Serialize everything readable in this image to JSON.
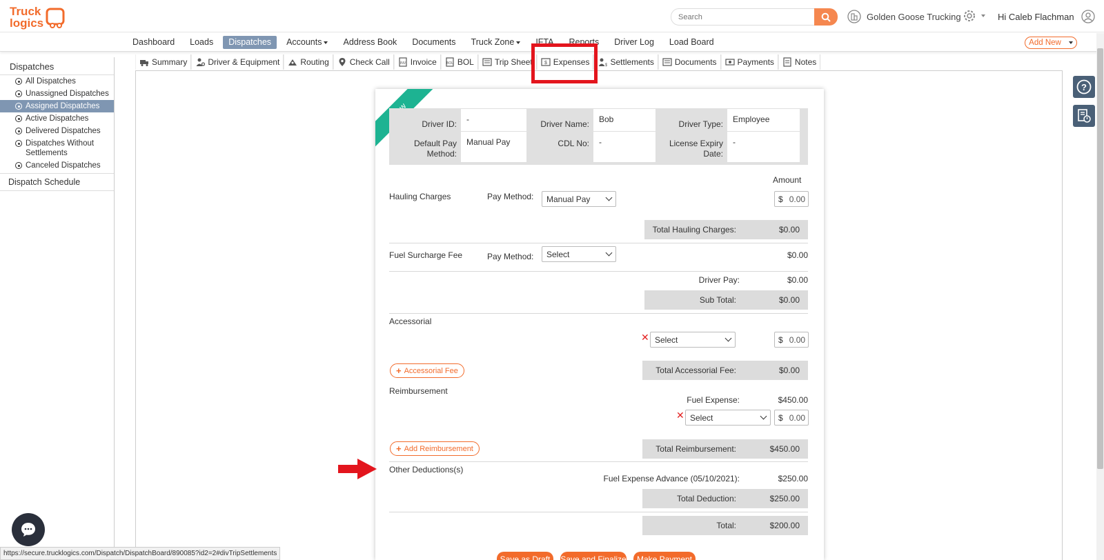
{
  "header": {
    "logo_text": "Truck logics",
    "search_placeholder": "Search",
    "company_name": "Golden Goose Trucking",
    "greeting": "Hi Caleb Flachman",
    "add_new_label": "Add New"
  },
  "main_nav": [
    {
      "label": "Dashboard",
      "active": false,
      "dropdown": false
    },
    {
      "label": "Loads",
      "active": false,
      "dropdown": false
    },
    {
      "label": "Dispatches",
      "active": true,
      "dropdown": false
    },
    {
      "label": "Accounts",
      "active": false,
      "dropdown": true
    },
    {
      "label": "Address Book",
      "active": false,
      "dropdown": false
    },
    {
      "label": "Documents",
      "active": false,
      "dropdown": false
    },
    {
      "label": "Truck Zone",
      "active": false,
      "dropdown": true
    },
    {
      "label": "IFTA",
      "active": false,
      "dropdown": false
    },
    {
      "label": "Reports",
      "active": false,
      "dropdown": false
    },
    {
      "label": "Driver Log",
      "active": false,
      "dropdown": false
    },
    {
      "label": "Load Board",
      "active": false,
      "dropdown": false
    }
  ],
  "sidebar": {
    "title": "Dispatches",
    "items": [
      {
        "label": "All Dispatches",
        "active": false
      },
      {
        "label": "Unassigned Dispatches",
        "active": false
      },
      {
        "label": "Assigned Dispatches",
        "active": true
      },
      {
        "label": "Active Dispatches",
        "active": false
      },
      {
        "label": "Delivered Dispatches",
        "active": false
      },
      {
        "label": "Dispatches Without Settlements",
        "active": false
      },
      {
        "label": "Canceled Dispatches",
        "active": false
      }
    ],
    "schedule_label": "Dispatch Schedule"
  },
  "subtabs": [
    {
      "label": "Summary",
      "icon": "truck-icon"
    },
    {
      "label": "Driver & Equipment",
      "icon": "driver-icon"
    },
    {
      "label": "Routing",
      "icon": "routing-icon"
    },
    {
      "label": "Check Call",
      "icon": "map-pin-icon"
    },
    {
      "label": "Invoice",
      "icon": "invoice-icon"
    },
    {
      "label": "BOL",
      "icon": "bol-icon"
    },
    {
      "label": "Trip Sheet",
      "icon": "trip-sheet-icon"
    },
    {
      "label": "Expenses",
      "icon": "expenses-icon"
    },
    {
      "label": "Settlements",
      "icon": "settlements-icon"
    },
    {
      "label": "Documents",
      "icon": "documents-icon"
    },
    {
      "label": "Payments",
      "icon": "payments-icon"
    },
    {
      "label": "Notes",
      "icon": "notes-icon"
    }
  ],
  "settlement": {
    "ribbon": "New",
    "driver": {
      "id_label": "Driver ID:",
      "id_value": "-",
      "name_label": "Driver Name:",
      "name_value": "Bob",
      "type_label": "Driver Type:",
      "type_value": "Employee",
      "pay_method_label": "Default Pay Method:",
      "pay_method_value": "Manual Pay",
      "cdl_label": "CDL No:",
      "cdl_value": "-",
      "license_label": "License Expiry Date:",
      "license_value": "-"
    },
    "amount_header": "Amount",
    "hauling": {
      "label": "Hauling Charges",
      "pay_method_label": "Pay Method:",
      "pay_method_value": "Manual Pay",
      "currency": "$",
      "amount": "0.00",
      "total_label": "Total Hauling Charges:",
      "total_value": "$0.00"
    },
    "fuel_surcharge": {
      "label": "Fuel Surcharge Fee",
      "pay_method_label": "Pay Method:",
      "pay_method_value": "Select",
      "amount": "$0.00"
    },
    "driver_pay": {
      "label": "Driver Pay:",
      "value": "$0.00"
    },
    "sub_total": {
      "label": "Sub Total:",
      "value": "$0.00"
    },
    "accessorial": {
      "label": "Accessorial",
      "select_value": "Select",
      "currency": "$",
      "amount": "0.00",
      "add_label": "Accessorial Fee",
      "total_label": "Total Accessorial Fee:",
      "total_value": "$0.00"
    },
    "reimbursement": {
      "label": "Reimbursement",
      "fuel_expense_label": "Fuel Expense:",
      "fuel_expense_value": "$450.00",
      "select_value": "Select",
      "currency": "$",
      "amount": "0.00",
      "add_label": "Add Reimbursement",
      "total_label": "Total Reimbursement:",
      "total_value": "$450.00"
    },
    "deductions": {
      "label": "Other Deductions(s)",
      "advance_label": "Fuel Expense Advance (05/10/2021):",
      "advance_value": "$250.00",
      "total_label": "Total Deduction:",
      "total_value": "$250.00"
    },
    "total": {
      "label": "Total:",
      "value": "$200.00"
    },
    "actions": {
      "save_draft": "Save as Draft",
      "save_finalize": "Save and Finalize",
      "make_payment": "Make Payment"
    }
  },
  "status_url": "https://secure.trucklogics.com/Dispatch/DispatchBoard/890085?id2=2#divTripSettlements",
  "colors": {
    "accent": "#f26b2b",
    "nav_active": "#7f96b2",
    "ribbon": "#1db392",
    "highlight": "#e3151d"
  }
}
